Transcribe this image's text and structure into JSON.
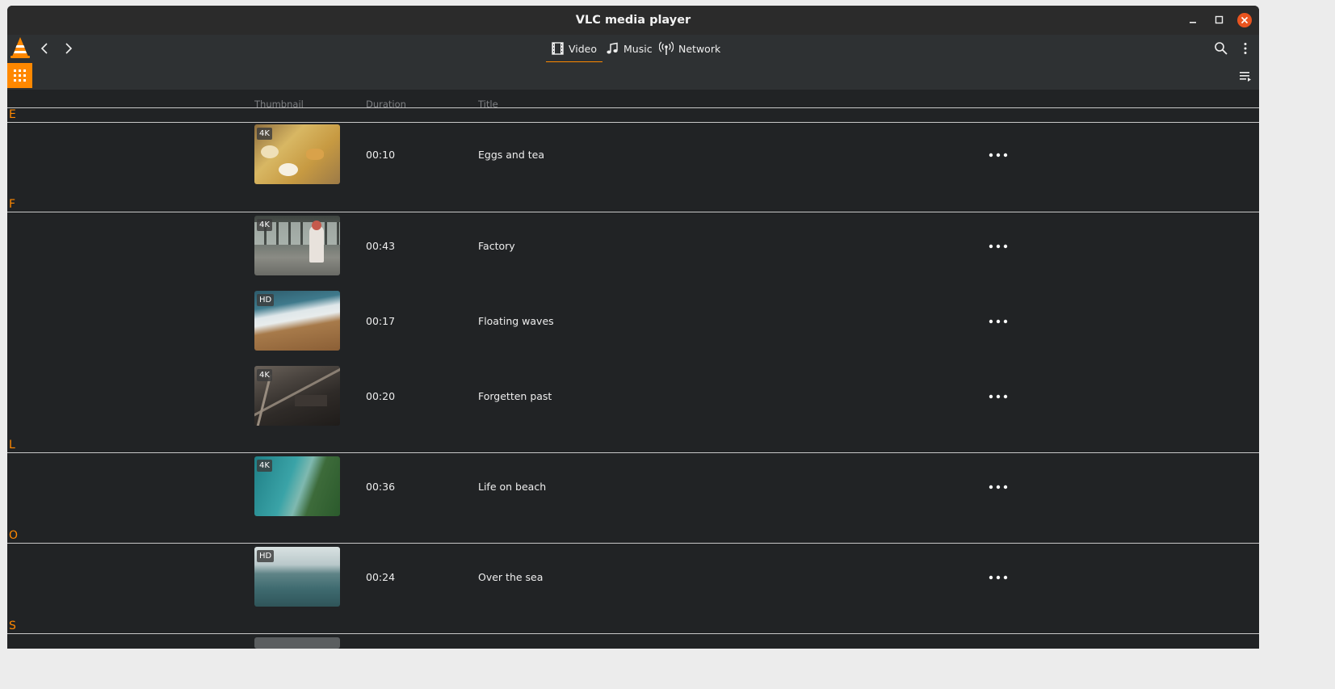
{
  "window": {
    "title": "VLC media player"
  },
  "colors": {
    "accent": "#ff8800",
    "background": "#212325",
    "toolbar": "#2e3133",
    "titlebar": "#2b2b2b",
    "close": "#e9541f"
  },
  "toolbar": {
    "tabs": [
      {
        "label": "Video",
        "icon": "video-film-icon",
        "active": true
      },
      {
        "label": "Music",
        "icon": "music-note-icon",
        "active": false
      },
      {
        "label": "Network",
        "icon": "network-antenna-icon",
        "active": false
      }
    ]
  },
  "columns": {
    "thumbnail": "Thumbnail",
    "duration": "Duration",
    "title": "Title"
  },
  "groups": [
    {
      "letter": "E",
      "items": [
        {
          "badge": "4K",
          "duration": "00:10",
          "title": "Eggs and tea"
        }
      ]
    },
    {
      "letter": "F",
      "items": [
        {
          "badge": "4K",
          "duration": "00:43",
          "title": "Factory"
        },
        {
          "badge": "HD",
          "duration": "00:17",
          "title": "Floating waves"
        },
        {
          "badge": "4K",
          "duration": "00:20",
          "title": "Forgetten past"
        }
      ]
    },
    {
      "letter": "L",
      "items": [
        {
          "badge": "4K",
          "duration": "00:36",
          "title": "Life on beach"
        }
      ]
    },
    {
      "letter": "O",
      "items": [
        {
          "badge": "HD",
          "duration": "00:24",
          "title": "Over the sea"
        }
      ]
    },
    {
      "letter": "S",
      "items": []
    }
  ]
}
